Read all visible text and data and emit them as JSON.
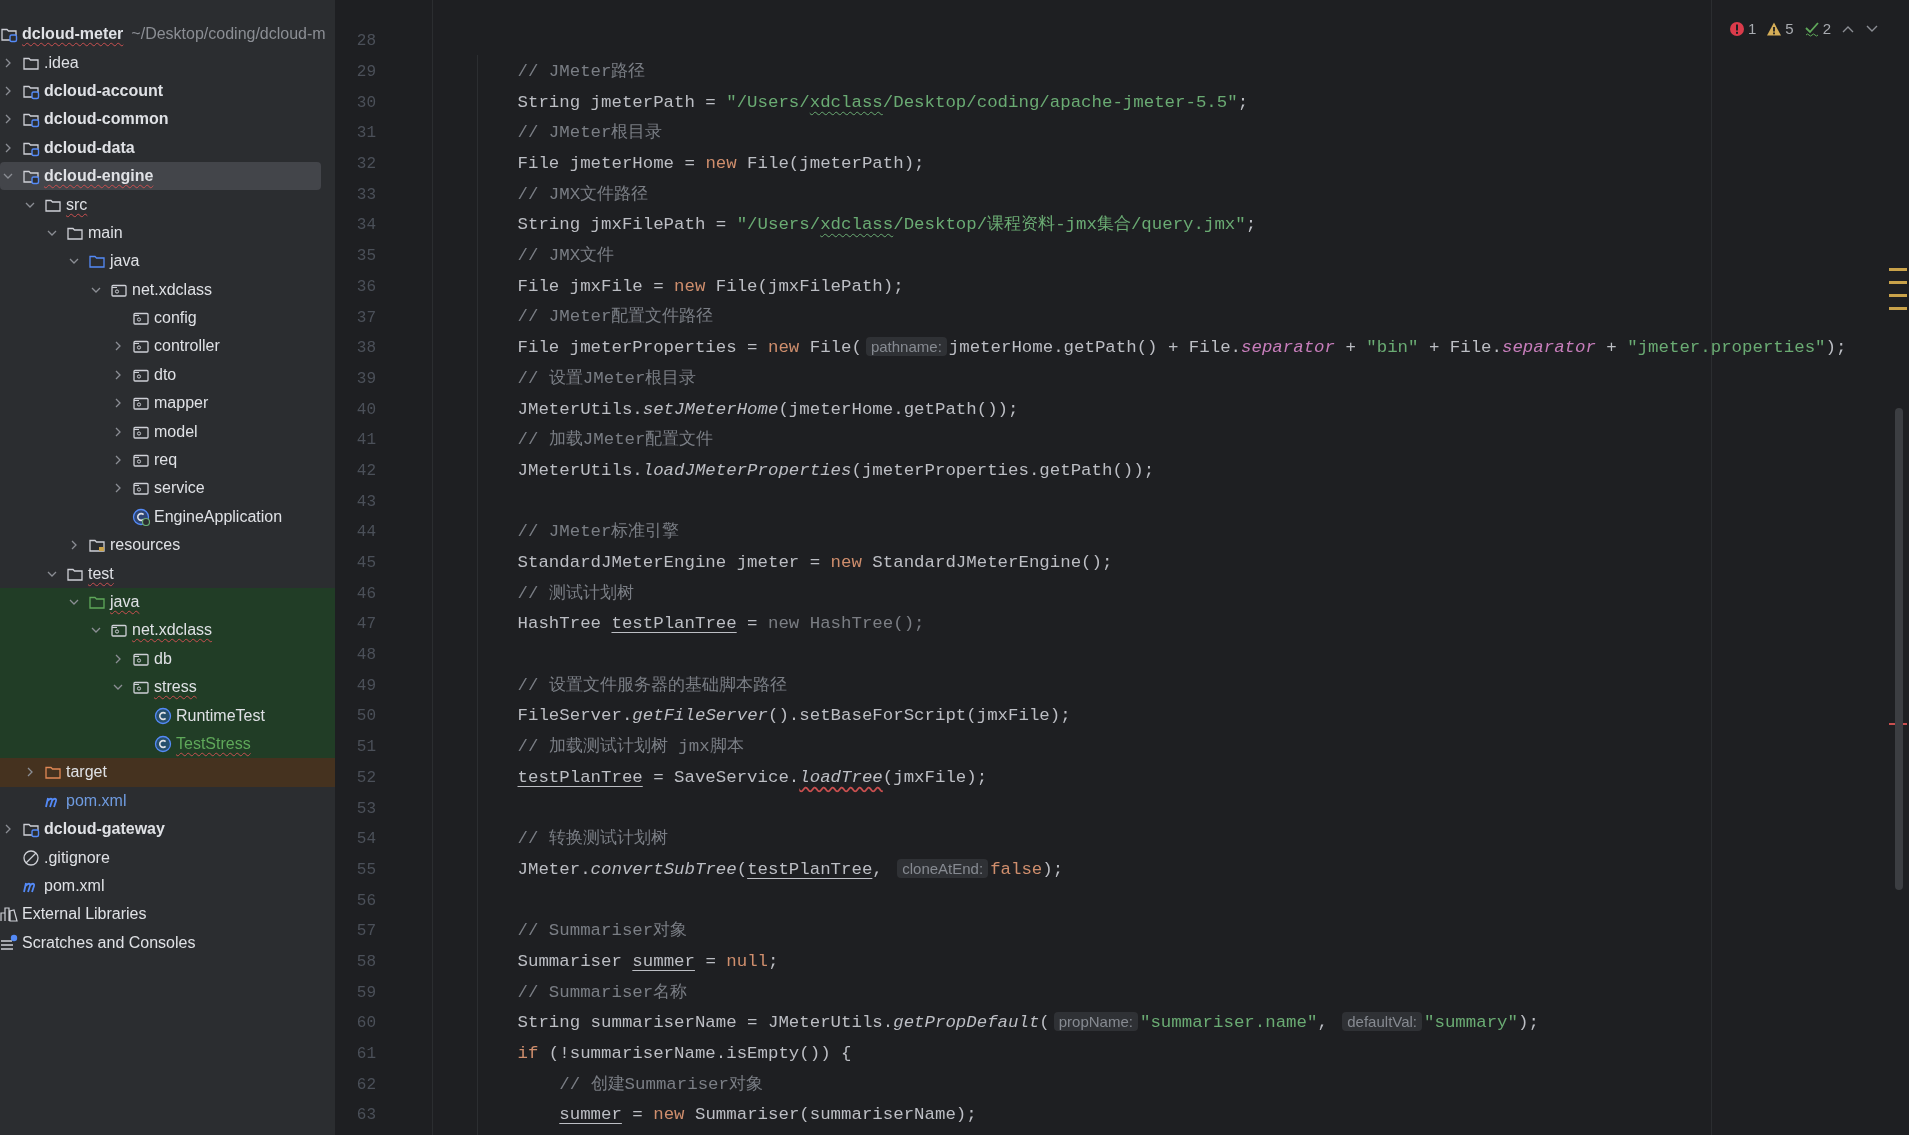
{
  "project_tree": [
    {
      "label": "dcloud-meter",
      "path": "~/Desktop/coding/dcloud-m",
      "kind": "module",
      "selected": false,
      "error": true,
      "test": false,
      "excluded": false,
      "new_file": false,
      "modified": false,
      "children": [
        {
          "label": ".idea",
          "kind": "folder",
          "selected": false,
          "error": false,
          "test": false,
          "excluded": false,
          "new_file": false,
          "modified": false,
          "expanded": false
        },
        {
          "label": "dcloud-account",
          "kind": "module",
          "selected": false,
          "error": false,
          "test": false,
          "excluded": false,
          "new_file": false,
          "modified": false,
          "expanded": false
        },
        {
          "label": "dcloud-common",
          "kind": "module",
          "selected": false,
          "error": false,
          "test": false,
          "excluded": false,
          "new_file": false,
          "modified": false,
          "expanded": false
        },
        {
          "label": "dcloud-data",
          "kind": "module",
          "selected": false,
          "error": false,
          "test": false,
          "excluded": false,
          "new_file": false,
          "modified": false,
          "expanded": false
        },
        {
          "label": "dcloud-engine",
          "kind": "module",
          "selected": true,
          "error": true,
          "test": false,
          "excluded": false,
          "new_file": false,
          "modified": false,
          "expanded": true,
          "children": [
            {
              "label": "src",
              "kind": "folder",
              "selected": false,
              "error": true,
              "test": false,
              "excluded": false,
              "new_file": false,
              "modified": false,
              "expanded": true,
              "children": [
                {
                  "label": "main",
                  "kind": "folder",
                  "selected": false,
                  "error": false,
                  "test": false,
                  "excluded": false,
                  "new_file": false,
                  "modified": false,
                  "expanded": true,
                  "children": [
                    {
                      "label": "java",
                      "kind": "source",
                      "selected": false,
                      "error": false,
                      "test": false,
                      "excluded": false,
                      "new_file": false,
                      "modified": false,
                      "expanded": true,
                      "children": [
                        {
                          "label": "net.xdclass",
                          "kind": "package",
                          "selected": false,
                          "error": false,
                          "test": false,
                          "excluded": false,
                          "new_file": false,
                          "modified": false,
                          "expanded": true,
                          "children": [
                            {
                              "label": "config",
                              "kind": "package",
                              "selected": false,
                              "error": false,
                              "test": false,
                              "excluded": false,
                              "new_file": false,
                              "modified": false
                            },
                            {
                              "label": "controller",
                              "kind": "package",
                              "selected": false,
                              "error": false,
                              "test": false,
                              "excluded": false,
                              "new_file": false,
                              "modified": false,
                              "expanded": false
                            },
                            {
                              "label": "dto",
                              "kind": "package",
                              "selected": false,
                              "error": false,
                              "test": false,
                              "excluded": false,
                              "new_file": false,
                              "modified": false,
                              "expanded": false
                            },
                            {
                              "label": "mapper",
                              "kind": "package",
                              "selected": false,
                              "error": false,
                              "test": false,
                              "excluded": false,
                              "new_file": false,
                              "modified": false,
                              "expanded": false
                            },
                            {
                              "label": "model",
                              "kind": "package",
                              "selected": false,
                              "error": false,
                              "test": false,
                              "excluded": false,
                              "new_file": false,
                              "modified": false,
                              "expanded": false
                            },
                            {
                              "label": "req",
                              "kind": "package",
                              "selected": false,
                              "error": false,
                              "test": false,
                              "excluded": false,
                              "new_file": false,
                              "modified": false,
                              "expanded": false
                            },
                            {
                              "label": "service",
                              "kind": "package",
                              "selected": false,
                              "error": false,
                              "test": false,
                              "excluded": false,
                              "new_file": false,
                              "modified": false,
                              "expanded": false
                            },
                            {
                              "label": "EngineApplication",
                              "kind": "app",
                              "selected": false,
                              "error": false,
                              "test": false,
                              "excluded": false,
                              "new_file": false,
                              "modified": false
                            }
                          ]
                        }
                      ]
                    },
                    {
                      "label": "resources",
                      "kind": "resources",
                      "selected": false,
                      "error": false,
                      "test": false,
                      "excluded": false,
                      "new_file": false,
                      "modified": false,
                      "expanded": false
                    }
                  ]
                },
                {
                  "label": "test",
                  "kind": "folder",
                  "selected": false,
                  "error": true,
                  "test": false,
                  "excluded": false,
                  "new_file": false,
                  "modified": false,
                  "expanded": true,
                  "children": [
                    {
                      "label": "java",
                      "kind": "testsource",
                      "selected": false,
                      "error": true,
                      "test": true,
                      "excluded": false,
                      "new_file": false,
                      "modified": false,
                      "expanded": true,
                      "children": [
                        {
                          "label": "net.xdclass",
                          "kind": "package",
                          "selected": false,
                          "error": true,
                          "test": true,
                          "excluded": false,
                          "new_file": false,
                          "modified": false,
                          "expanded": true,
                          "children": [
                            {
                              "label": "db",
                              "kind": "package",
                              "selected": false,
                              "error": false,
                              "test": true,
                              "excluded": false,
                              "new_file": false,
                              "modified": false,
                              "expanded": false
                            },
                            {
                              "label": "stress",
                              "kind": "package",
                              "selected": false,
                              "error": true,
                              "test": true,
                              "excluded": false,
                              "new_file": false,
                              "modified": false,
                              "expanded": true,
                              "children": [
                                {
                                  "label": "RuntimeTest",
                                  "kind": "class",
                                  "selected": false,
                                  "error": false,
                                  "test": true,
                                  "excluded": false,
                                  "new_file": false,
                                  "modified": false
                                },
                                {
                                  "label": "TestStress",
                                  "kind": "class",
                                  "selected": false,
                                  "error": true,
                                  "test": true,
                                  "excluded": false,
                                  "new_file": true,
                                  "modified": false
                                }
                              ]
                            }
                          ]
                        }
                      ]
                    }
                  ]
                }
              ]
            },
            {
              "label": "target",
              "kind": "folder",
              "selected": false,
              "error": false,
              "test": false,
              "excluded": true,
              "new_file": false,
              "modified": false,
              "expanded": false
            },
            {
              "label": "pom.xml",
              "kind": "maven",
              "selected": false,
              "error": false,
              "test": false,
              "excluded": false,
              "new_file": false,
              "modified": true
            }
          ]
        },
        {
          "label": "dcloud-gateway",
          "kind": "module",
          "selected": false,
          "error": false,
          "test": false,
          "excluded": false,
          "new_file": false,
          "modified": false,
          "expanded": false
        },
        {
          "label": ".gitignore",
          "kind": "ignore",
          "selected": false,
          "error": false,
          "test": false,
          "excluded": false,
          "new_file": false,
          "modified": false
        },
        {
          "label": "pom.xml",
          "kind": "maven",
          "selected": false,
          "error": false,
          "test": false,
          "excluded": false,
          "new_file": false,
          "modified": false
        }
      ]
    },
    {
      "label": "External Libraries",
      "kind": "libraries",
      "selected": false,
      "error": false,
      "test": false,
      "excluded": false,
      "new_file": false,
      "modified": false
    },
    {
      "label": "Scratches and Consoles",
      "kind": "scratches",
      "selected": false,
      "error": false,
      "test": false,
      "excluded": false,
      "new_file": false,
      "modified": false
    }
  ],
  "inspections": [
    {
      "kind": "error",
      "count": "1"
    },
    {
      "kind": "warning",
      "count": "5"
    },
    {
      "kind": "typo",
      "count": "2"
    }
  ],
  "code_lines": [
    {
      "number": "28"
    },
    {
      "number": "29",
      "tokens": [
        {
          "kind": "comment",
          "text": "// JMeter路径"
        }
      ]
    },
    {
      "number": "30",
      "tokens": [
        {
          "kind": "plain",
          "text": "String jmeterPath = "
        },
        {
          "kind": "string",
          "text": "\"/Users/"
        },
        {
          "kind": "typo",
          "text": "xdclass"
        },
        {
          "kind": "string",
          "text": "/Desktop/coding/apache-jmeter-5.5\""
        },
        {
          "kind": "plain",
          "text": ";"
        }
      ]
    },
    {
      "number": "31",
      "tokens": [
        {
          "kind": "comment",
          "text": "// JMeter根目录"
        }
      ]
    },
    {
      "number": "32",
      "tokens": [
        {
          "kind": "plain",
          "text": "File jmeterHome = "
        },
        {
          "kind": "keyword",
          "text": "new"
        },
        {
          "kind": "plain",
          "text": " File(jmeterPath);"
        }
      ]
    },
    {
      "number": "33",
      "tokens": [
        {
          "kind": "comment",
          "text": "// JMX文件路径"
        }
      ]
    },
    {
      "number": "34",
      "tokens": [
        {
          "kind": "plain",
          "text": "String jmxFilePath = "
        },
        {
          "kind": "string",
          "text": "\"/Users/"
        },
        {
          "kind": "typo",
          "text": "xdclass"
        },
        {
          "kind": "string",
          "text": "/Desktop/课程资料-jmx集合/query.jmx\""
        },
        {
          "kind": "plain",
          "text": ";"
        }
      ]
    },
    {
      "number": "35",
      "tokens": [
        {
          "kind": "comment",
          "text": "// JMX文件"
        }
      ]
    },
    {
      "number": "36",
      "tokens": [
        {
          "kind": "plain",
          "text": "File jmxFile = "
        },
        {
          "kind": "keyword",
          "text": "new"
        },
        {
          "kind": "plain",
          "text": " File(jmxFilePath);"
        }
      ]
    },
    {
      "number": "37",
      "tokens": [
        {
          "kind": "comment",
          "text": "// JMeter配置文件路径"
        }
      ]
    },
    {
      "number": "38",
      "tokens": [
        {
          "kind": "plain",
          "text": "File jmeterProperties = "
        },
        {
          "kind": "keyword",
          "text": "new"
        },
        {
          "kind": "plain",
          "text": " File("
        },
        {
          "kind": "hint",
          "text": "pathname:"
        },
        {
          "kind": "plain",
          "text": "jmeterHome.getPath() + File."
        },
        {
          "kind": "field",
          "text": "separator"
        },
        {
          "kind": "plain",
          "text": " + "
        },
        {
          "kind": "string",
          "text": "\"bin\""
        },
        {
          "kind": "plain",
          "text": " + File."
        },
        {
          "kind": "field",
          "text": "separator"
        },
        {
          "kind": "plain",
          "text": " + "
        },
        {
          "kind": "string",
          "text": "\"jmeter.properties\""
        },
        {
          "kind": "plain",
          "text": ");"
        }
      ]
    },
    {
      "number": "39",
      "tokens": [
        {
          "kind": "comment",
          "text": "// 设置JMeter根目录"
        }
      ]
    },
    {
      "number": "40",
      "tokens": [
        {
          "kind": "plain",
          "text": "JMeterUtils."
        },
        {
          "kind": "static",
          "text": "setJMeterHome"
        },
        {
          "kind": "plain",
          "text": "(jmeterHome.getPath());"
        }
      ]
    },
    {
      "number": "41",
      "tokens": [
        {
          "kind": "comment",
          "text": "// 加载JMeter配置文件"
        }
      ]
    },
    {
      "number": "42",
      "tokens": [
        {
          "kind": "plain",
          "text": "JMeterUtils."
        },
        {
          "kind": "static",
          "text": "loadJMeterProperties"
        },
        {
          "kind": "plain",
          "text": "(jmeterProperties.getPath());"
        }
      ]
    },
    {
      "number": "43"
    },
    {
      "number": "44",
      "tokens": [
        {
          "kind": "comment",
          "text": "// JMeter标准引擎"
        }
      ]
    },
    {
      "number": "45",
      "tokens": [
        {
          "kind": "plain",
          "text": "StandardJMeterEngine jmeter = "
        },
        {
          "kind": "keyword",
          "text": "new"
        },
        {
          "kind": "plain",
          "text": " StandardJMeterEngine();"
        }
      ]
    },
    {
      "number": "46",
      "tokens": [
        {
          "kind": "comment",
          "text": "// 测试计划树"
        }
      ]
    },
    {
      "number": "47",
      "tokens": [
        {
          "kind": "plain",
          "text": "HashTree "
        },
        {
          "kind": "reassigned",
          "text": "testPlanTree"
        },
        {
          "kind": "plain",
          "text": " = "
        },
        {
          "kind": "unused",
          "text": "new HashTree();"
        }
      ]
    },
    {
      "number": "48"
    },
    {
      "number": "49",
      "tokens": [
        {
          "kind": "comment",
          "text": "// 设置文件服务器的基础脚本路径"
        }
      ]
    },
    {
      "number": "50",
      "tokens": [
        {
          "kind": "plain",
          "text": "FileServer."
        },
        {
          "kind": "static",
          "text": "getFileServer"
        },
        {
          "kind": "plain",
          "text": "().setBaseForScript(jmxFile);"
        }
      ]
    },
    {
      "number": "51",
      "tokens": [
        {
          "kind": "comment",
          "text": "// 加载测试计划树 jmx脚本"
        }
      ]
    },
    {
      "number": "52",
      "tokens": [
        {
          "kind": "reassigned",
          "text": "testPlanTree"
        },
        {
          "kind": "plain",
          "text": " = SaveService."
        },
        {
          "kind": "static-error",
          "text": "loadTree"
        },
        {
          "kind": "plain",
          "text": "(jmxFile);"
        }
      ]
    },
    {
      "number": "53"
    },
    {
      "number": "54",
      "tokens": [
        {
          "kind": "comment",
          "text": "// 转换测试计划树"
        }
      ]
    },
    {
      "number": "55",
      "tokens": [
        {
          "kind": "plain",
          "text": "JMeter."
        },
        {
          "kind": "static",
          "text": "convertSubTree"
        },
        {
          "kind": "plain",
          "text": "("
        },
        {
          "kind": "reassigned",
          "text": "testPlanTree"
        },
        {
          "kind": "plain",
          "text": ", "
        },
        {
          "kind": "hint",
          "text": "cloneAtEnd:"
        },
        {
          "kind": "keyword",
          "text": "false"
        },
        {
          "kind": "plain",
          "text": ");"
        }
      ]
    },
    {
      "number": "56"
    },
    {
      "number": "57",
      "tokens": [
        {
          "kind": "comment",
          "text": "// Summariser对象"
        }
      ]
    },
    {
      "number": "58",
      "tokens": [
        {
          "kind": "plain",
          "text": "Summariser "
        },
        {
          "kind": "reassigned",
          "text": "summer"
        },
        {
          "kind": "plain",
          "text": " = "
        },
        {
          "kind": "keyword",
          "text": "null"
        },
        {
          "kind": "plain",
          "text": ";"
        }
      ]
    },
    {
      "number": "59",
      "tokens": [
        {
          "kind": "comment",
          "text": "// Summariser名称"
        }
      ]
    },
    {
      "number": "60",
      "tokens": [
        {
          "kind": "plain",
          "text": "String summariserName = JMeterUtils."
        },
        {
          "kind": "static",
          "text": "getPropDefault"
        },
        {
          "kind": "plain",
          "text": "("
        },
        {
          "kind": "hint",
          "text": "propName:"
        },
        {
          "kind": "string",
          "text": "\"summariser.name\""
        },
        {
          "kind": "plain",
          "text": ", "
        },
        {
          "kind": "hint",
          "text": "defaultVal:"
        },
        {
          "kind": "string",
          "text": "\"summary\""
        },
        {
          "kind": "plain",
          "text": ");"
        }
      ]
    },
    {
      "number": "61",
      "tokens": [
        {
          "kind": "keyword",
          "text": "if"
        },
        {
          "kind": "plain",
          "text": " (!summariserName.isEmpty()) {"
        }
      ],
      "children": [
        {
          "number": "62",
          "tokens": [
            {
              "kind": "comment",
              "text": "// 创建Summariser对象"
            }
          ]
        },
        {
          "number": "63",
          "tokens": [
            {
              "kind": "reassigned",
              "text": "summer"
            },
            {
              "kind": "plain",
              "text": " = "
            },
            {
              "kind": "keyword",
              "text": "new"
            },
            {
              "kind": "plain",
              "text": " Summariser(summariserName);"
            }
          ]
        }
      ]
    }
  ]
}
